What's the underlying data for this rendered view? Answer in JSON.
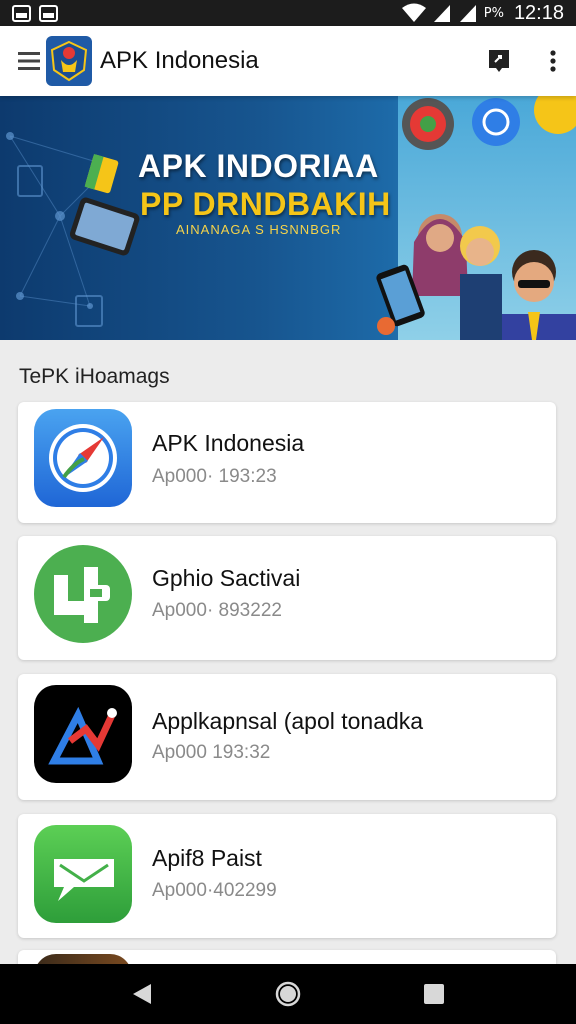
{
  "status_bar": {
    "battery": "P%",
    "time": "12:18"
  },
  "app_bar": {
    "title": "APK Indonesia",
    "icons": [
      "hamburger-menu-icon",
      "app-logo-icon",
      "share-icon",
      "more-vert-icon"
    ]
  },
  "banner": {
    "title_line1": "APK INDORIAA",
    "title_line2": "PP DRNDBAKIH",
    "subtitle": "AINANAGA S HSNNBGR",
    "colors": {
      "title1": "#ffffff",
      "title2": "#f5c518",
      "subtitle": "#f5d34a"
    }
  },
  "section": {
    "title": "TePK iHoamags"
  },
  "apps": [
    {
      "name": "APK Indonesia",
      "meta": "Ap000· 193:23",
      "icon": "compass-icon",
      "color": "#2f7ee6"
    },
    {
      "name": "Gphio Sactivai",
      "meta": "Ap000· 893222",
      "icon": "green-plus-app-icon",
      "color": "#4caf50"
    },
    {
      "name": "Applkapnsal (apol tonadka",
      "meta": "Ap000 193:32",
      "icon": "triangle-app-icon",
      "color": "#000000"
    },
    {
      "name": "Apif8 Paist",
      "meta": "Ap000·402299",
      "icon": "message-app-icon",
      "color": "#43b049"
    }
  ],
  "nav_bar": {
    "icons": [
      "back-icon",
      "home-icon",
      "recents-icon"
    ]
  }
}
